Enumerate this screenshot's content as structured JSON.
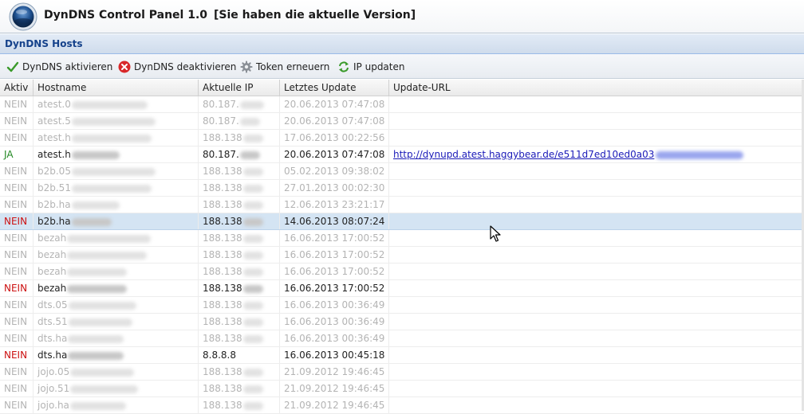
{
  "app": {
    "title": "DynDNS Control Panel 1.0",
    "version_note": "[Sie haben die aktuelle Version]"
  },
  "panel": {
    "title": "DynDNS Hosts"
  },
  "toolbar": {
    "activate": "DynDNS aktivieren",
    "deactivate": "DynDNS deaktivieren",
    "token": "Token erneuern",
    "ip_update": "IP updaten"
  },
  "columns": {
    "aktiv": "Aktiv",
    "hostname": "Hostname",
    "ip": "Aktuelle IP",
    "last_update": "Letztes Update",
    "url": "Update-URL"
  },
  "rows": [
    {
      "aktiv": "NEIN",
      "host": "atest.0",
      "ip": "80.187.",
      "upd": "20.06.2013 07:47:08",
      "url": "",
      "active": false
    },
    {
      "aktiv": "NEIN",
      "host": "atest.5",
      "ip": "80.187.",
      "upd": "20.06.2013 07:47:08",
      "url": "",
      "active": false
    },
    {
      "aktiv": "NEIN",
      "host": "atest.h",
      "ip": "188.138",
      "upd": "17.06.2013 00:22:56",
      "url": "",
      "active": false
    },
    {
      "aktiv": "JA",
      "host": "atest.h",
      "ip": "80.187.",
      "upd": "20.06.2013 07:47:08",
      "url": "http://dynupd.atest.haggybear.de/e511d7ed10ed0a03",
      "active": true
    },
    {
      "aktiv": "NEIN",
      "host": "b2b.05",
      "ip": "188.138",
      "upd": "05.02.2013 09:38:02",
      "url": "",
      "active": false
    },
    {
      "aktiv": "NEIN",
      "host": "b2b.51",
      "ip": "188.138",
      "upd": "27.01.2013 00:02:30",
      "url": "",
      "active": false
    },
    {
      "aktiv": "NEIN",
      "host": "b2b.ha",
      "ip": "188.138",
      "upd": "12.06.2013 23:21:17",
      "url": "",
      "active": false
    },
    {
      "aktiv": "NEIN",
      "host": "b2b.ha",
      "ip": "188.138",
      "upd": "14.06.2013 08:07:24",
      "url": "",
      "active": true,
      "selected": true
    },
    {
      "aktiv": "NEIN",
      "host": "bezah",
      "ip": "188.138",
      "upd": "16.06.2013 17:00:52",
      "url": "",
      "active": false
    },
    {
      "aktiv": "NEIN",
      "host": "bezah",
      "ip": "188.138",
      "upd": "16.06.2013 17:00:52",
      "url": "",
      "active": false
    },
    {
      "aktiv": "NEIN",
      "host": "bezah",
      "ip": "188.138",
      "upd": "16.06.2013 17:00:52",
      "url": "",
      "active": false
    },
    {
      "aktiv": "NEIN",
      "host": "bezah",
      "ip": "188.138",
      "upd": "16.06.2013 17:00:52",
      "url": "",
      "active": true
    },
    {
      "aktiv": "NEIN",
      "host": "dts.05",
      "ip": "188.138",
      "upd": "16.06.2013 00:36:49",
      "url": "",
      "active": false
    },
    {
      "aktiv": "NEIN",
      "host": "dts.51",
      "ip": "188.138",
      "upd": "16.06.2013 00:36:49",
      "url": "",
      "active": false
    },
    {
      "aktiv": "NEIN",
      "host": "dts.ha",
      "ip": "188.138",
      "upd": "16.06.2013 00:36:49",
      "url": "",
      "active": false
    },
    {
      "aktiv": "NEIN",
      "host": "dts.ha",
      "ip": "8.8.8.8",
      "upd": "16.06.2013 00:45:18",
      "url": "",
      "active": true
    },
    {
      "aktiv": "NEIN",
      "host": "jojo.05",
      "ip": "188.138",
      "upd": "21.09.2012 19:46:45",
      "url": "",
      "active": false
    },
    {
      "aktiv": "NEIN",
      "host": "jojo.51",
      "ip": "188.138",
      "upd": "21.09.2012 19:46:45",
      "url": "",
      "active": false
    },
    {
      "aktiv": "NEIN",
      "host": "jojo.ha",
      "ip": "188.138",
      "upd": "21.09.2012 19:46:45",
      "url": "",
      "active": false
    }
  ],
  "colors": {
    "status_nein": "#cc1111",
    "status_ja": "#228822",
    "selected_row": "#d4e4f3",
    "panel_title": "#15428b"
  },
  "icons": {
    "logo": "dyndns-logo-icon",
    "activate": "green-check-icon",
    "deactivate": "red-x-icon",
    "token": "gear-icon",
    "ip_update": "refresh-arrows-icon"
  }
}
